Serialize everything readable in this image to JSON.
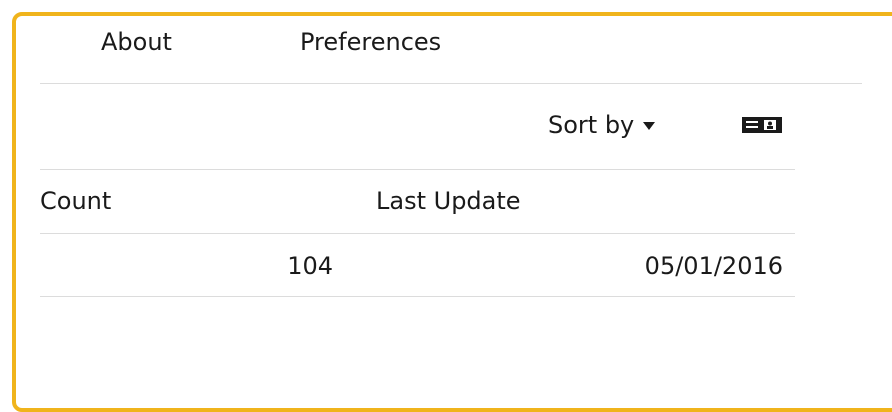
{
  "nav": {
    "items": [
      {
        "label": "About"
      },
      {
        "label": "Preferences"
      }
    ]
  },
  "toolbar": {
    "sort_label": "Sort by",
    "sort_icon": "caret-down-icon",
    "view_icon": "card-view-icon"
  },
  "table": {
    "columns": [
      {
        "label": "Count"
      },
      {
        "label": "Last Update"
      }
    ],
    "rows": [
      {
        "count": "104",
        "last_update": "05/01/2016"
      }
    ]
  },
  "colors": {
    "frame_border": "#f0b41c",
    "text": "#1a1a1a",
    "divider": "#dcdcdc"
  }
}
